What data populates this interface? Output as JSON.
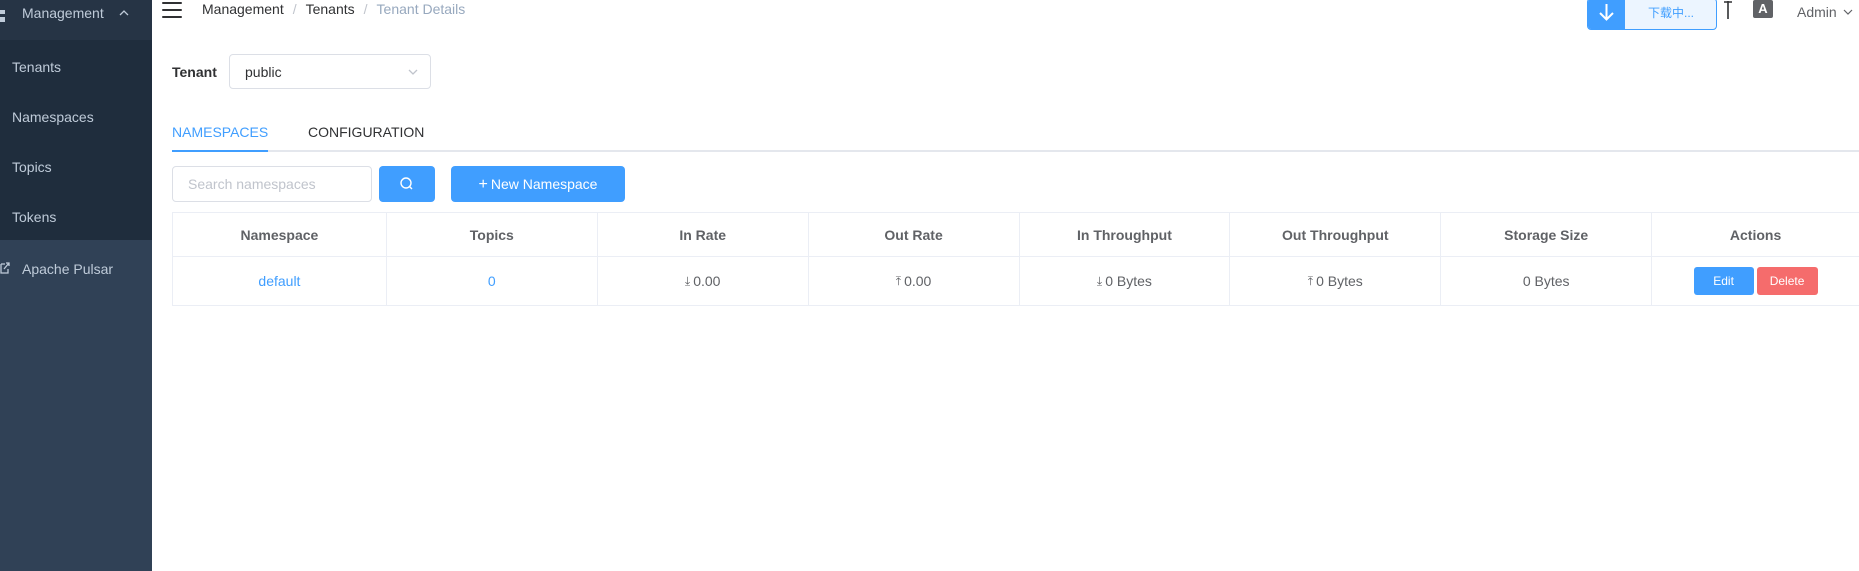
{
  "sidebar": {
    "menu_title": "Management",
    "items": [
      {
        "label": "Tenants"
      },
      {
        "label": "Namespaces"
      },
      {
        "label": "Topics"
      },
      {
        "label": "Tokens"
      }
    ],
    "external_link": "Apache Pulsar"
  },
  "header": {
    "breadcrumb": [
      "Management",
      "Tenants",
      "Tenant Details"
    ],
    "download_text": "下载中...",
    "user": "Admin"
  },
  "tenant": {
    "label": "Tenant",
    "selected": "public"
  },
  "tabs": [
    {
      "label": "NAMESPACES",
      "active": true
    },
    {
      "label": "CONFIGURATION",
      "active": false
    }
  ],
  "toolbar": {
    "search_placeholder": "Search namespaces",
    "new_button": "New Namespace"
  },
  "table": {
    "columns": [
      "Namespace",
      "Topics",
      "In Rate",
      "Out Rate",
      "In Throughput",
      "Out Throughput",
      "Storage Size",
      "Actions"
    ],
    "rows": [
      {
        "namespace": "default",
        "topics": "0",
        "in_rate": "0.00",
        "out_rate": "0.00",
        "in_throughput": "0 Bytes",
        "out_throughput": "0 Bytes",
        "storage_size": "0 Bytes",
        "edit_label": "Edit",
        "delete_label": "Delete"
      }
    ]
  },
  "colors": {
    "sidebar_bg": "#304156",
    "submenu_bg": "#1f2d3d",
    "primary": "#409eff",
    "danger": "#f56c6c"
  }
}
